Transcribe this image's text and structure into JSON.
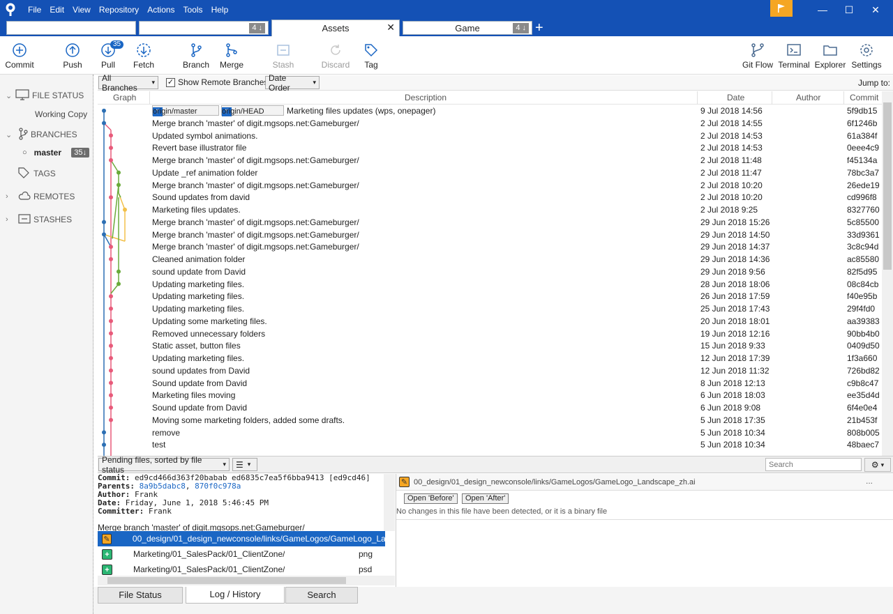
{
  "menu": [
    "File",
    "Edit",
    "View",
    "Repository",
    "Actions",
    "Tools",
    "Help"
  ],
  "tabs": [
    {
      "label": "",
      "badge": ""
    },
    {
      "label": "",
      "badge": "4 ↓"
    },
    {
      "label": "Assets",
      "badge": ""
    },
    {
      "label": "Game",
      "badge": "4 ↓"
    }
  ],
  "toolbar": {
    "commit": "Commit",
    "push": "Push",
    "pull": "Pull",
    "pull_badge": "35",
    "fetch": "Fetch",
    "branch": "Branch",
    "merge": "Merge",
    "stash": "Stash",
    "discard": "Discard",
    "tag": "Tag",
    "gitflow": "Git Flow",
    "terminal": "Terminal",
    "explorer": "Explorer",
    "settings": "Settings"
  },
  "sidebar": {
    "file_status": "FILE STATUS",
    "working_copy": "Working Copy",
    "branches": "BRANCHES",
    "master": "master",
    "master_badge": "35↓",
    "tags": "TAGS",
    "remotes": "REMOTES",
    "stashes": "STASHES"
  },
  "filter": {
    "branches": "All Branches",
    "show_remote": "Show Remote Branches",
    "order": "Date Order",
    "jump_to": "Jump to:"
  },
  "columns": {
    "graph": "Graph",
    "description": "Description",
    "date": "Date",
    "author": "Author",
    "commit": "Commit"
  },
  "refs": [
    "origin/master",
    "origin/HEAD"
  ],
  "commits": [
    {
      "desc": "Marketing files updates (wps, onepager)",
      "date": "9 Jul 2018 14:56",
      "hash": "5f9db15"
    },
    {
      "desc": "Merge branch 'master' of digit.mgsops.net:Gameburger/",
      "date": "2 Jul 2018 14:55",
      "hash": "6f1246b"
    },
    {
      "desc": "Updated symbol animations.",
      "date": "2 Jul 2018 14:53",
      "hash": "61a384f"
    },
    {
      "desc": "Revert base illustrator file",
      "date": "2 Jul 2018 14:53",
      "hash": "0eee4c9"
    },
    {
      "desc": "Merge branch 'master' of digit.mgsops.net:Gameburger/",
      "date": "2 Jul 2018 11:48",
      "hash": "f45134a"
    },
    {
      "desc": "Update _ref animation folder",
      "date": "2 Jul 2018 11:47",
      "hash": "78bc3a7"
    },
    {
      "desc": "Merge branch 'master' of digit.mgsops.net:Gameburger/",
      "date": "2 Jul 2018 10:20",
      "hash": "26ede19"
    },
    {
      "desc": "Sound updates from david",
      "date": "2 Jul 2018 10:20",
      "hash": "cd996f8"
    },
    {
      "desc": "Marketing files updates.",
      "date": "2 Jul 2018 9:25",
      "hash": "8327760"
    },
    {
      "desc": "Merge branch 'master' of digit.mgsops.net:Gameburger/",
      "date": "29 Jun 2018 15:26",
      "hash": "5c85500"
    },
    {
      "desc": "Merge branch 'master' of digit.mgsops.net:Gameburger/",
      "date": "29 Jun 2018 14:50",
      "hash": "33d9361"
    },
    {
      "desc": "Merge branch 'master' of digit.mgsops.net:Gameburger/",
      "date": "29 Jun 2018 14:37",
      "hash": "3c8c94d"
    },
    {
      "desc": "Cleaned animation folder",
      "date": "29 Jun 2018 14:36",
      "hash": "ac85580"
    },
    {
      "desc": "sound update from David",
      "date": "29 Jun 2018 9:56",
      "hash": "82f5d95"
    },
    {
      "desc": "Updating marketing files.",
      "date": "28 Jun 2018 18:06",
      "hash": "08c84cb"
    },
    {
      "desc": "Updating marketing files.",
      "date": "26 Jun 2018 17:59",
      "hash": "f40e95b"
    },
    {
      "desc": "Updating marketing files.",
      "date": "25 Jun 2018 17:43",
      "hash": "29f4fd0"
    },
    {
      "desc": "Updating some marketing files.",
      "date": "20 Jun 2018 18:01",
      "hash": "aa39383"
    },
    {
      "desc": "Removed unnecessary folders",
      "date": "19 Jun 2018 12:16",
      "hash": "90bb4b0"
    },
    {
      "desc": "Static asset, button files",
      "date": "15 Jun 2018 9:33",
      "hash": "0409d50"
    },
    {
      "desc": "Updating marketing files.",
      "date": "12 Jun 2018 17:39",
      "hash": "1f3a660"
    },
    {
      "desc": "sound updates from David",
      "date": "12 Jun 2018 11:32",
      "hash": "726bd82"
    },
    {
      "desc": "Sound update from David",
      "date": "8 Jun 2018 12:13",
      "hash": "c9b8c47"
    },
    {
      "desc": "Marketing files moving",
      "date": "6 Jun 2018 18:03",
      "hash": "ee35d4d"
    },
    {
      "desc": "Sound update from David",
      "date": "6 Jun 2018 9:08",
      "hash": "6f4e0e4"
    },
    {
      "desc": "Moving some marketing folders, added some drafts.",
      "date": "5 Jun 2018 17:35",
      "hash": "21b453f"
    },
    {
      "desc": "remove",
      "date": "5 Jun 2018 10:34",
      "hash": "808b005"
    },
    {
      "desc": "test",
      "date": "5 Jun 2018 10:34",
      "hash": "48baec7"
    }
  ],
  "pending": {
    "label": "Pending files, sorted by file status",
    "search_placeholder": "Search"
  },
  "commit_info": {
    "commit_label": "Commit:",
    "commit": "ed9cd466d363f20babab ed6835c7ea5f6bba9413 [ed9cd46]",
    "parents_label": "Parents:",
    "parent1": "8a9b5dabc8",
    "parent2": "870f0c978a",
    "author_label": "Author:",
    "author": "Frank",
    "date_label": "Date:",
    "date": "Friday, June 1, 2018 5:46:45 PM",
    "committer_label": "Committer:",
    "committer": "Frank",
    "message": "Merge branch 'master' of digit.mgsops.net:Gameburger/"
  },
  "files": [
    {
      "path": "00_design/01_design_newconsole/links/GameLogos/GameLogo_Landsca",
      "ext": "",
      "status": "modified"
    },
    {
      "path": "Marketing/01_SalesPack/01_ClientZone/",
      "ext": "png",
      "status": "added"
    },
    {
      "path": "Marketing/01_SalesPack/01_ClientZone/",
      "ext": "psd",
      "status": "added"
    }
  ],
  "diff": {
    "file": "00_design/01_design_newconsole/links/GameLogos/GameLogo_Landscape_zh.ai",
    "open_before": "Open 'Before'",
    "open_after": "Open 'After'",
    "message": "No changes in this file have been detected, or it is a binary file",
    "more": "..."
  },
  "bottom_tabs": [
    "File Status",
    "Log / History",
    "Search"
  ]
}
